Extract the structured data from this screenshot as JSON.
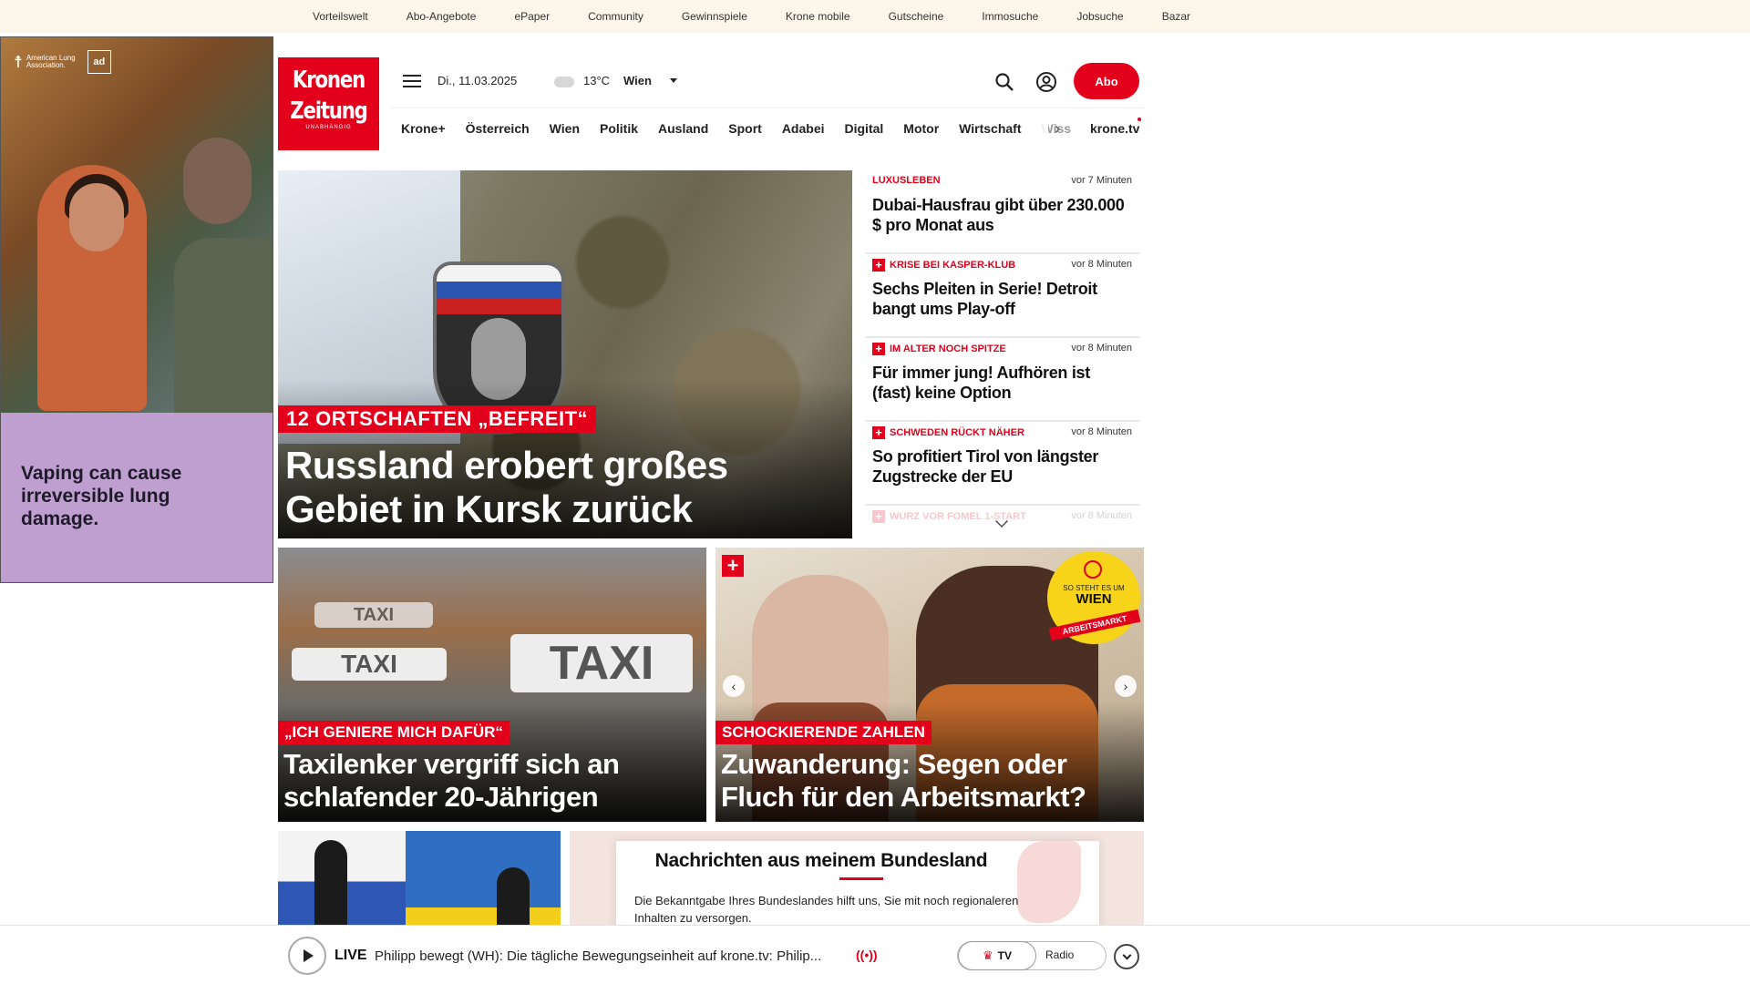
{
  "topbar": {
    "links": [
      "Vorteilswelt",
      "Abo-Angebote",
      "ePaper",
      "Community",
      "Gewinnspiele",
      "Krone mobile",
      "Gutscheine",
      "Immosuche",
      "Jobsuche",
      "Bazar"
    ]
  },
  "ad": {
    "brand": "American Lung Association.",
    "council": "ad",
    "text": "Vaping can cause irreversible lung damage."
  },
  "header": {
    "logo_line1": "Kronen",
    "logo_line2": "Zeitung",
    "logo_sub": "UNABHÄNGIG",
    "date": "Di., 11.03.2025",
    "temperature": "13°C",
    "city": "Wien",
    "abo_label": "Abo",
    "icons": [
      "menu-icon",
      "cloud-icon",
      "search-icon",
      "user-icon"
    ]
  },
  "nav": {
    "items": [
      "Krone+",
      "Österreich",
      "Wien",
      "Politik",
      "Ausland",
      "Sport",
      "Adabei",
      "Digital",
      "Motor",
      "Wirtschaft",
      "Wiss"
    ],
    "tv": "krone.tv"
  },
  "hero": {
    "kicker": "12 ORTSCHAFTEN „BEFREIT“",
    "title": "Russland erobert großes Gebiet in Kursk zurück"
  },
  "ticker": {
    "items": [
      {
        "kicker": "LUXUSLEBEN",
        "plus": false,
        "time": "vor 7 Minuten",
        "title": "Dubai-Hausfrau gibt über 230.000 $ pro Monat aus"
      },
      {
        "kicker": "KRISE BEI KASPER-KLUB",
        "plus": true,
        "time": "vor 8 Minuten",
        "title": "Sechs Pleiten in Serie! Detroit bangt ums Play-off"
      },
      {
        "kicker": "IM ALTER NOCH SPITZE",
        "plus": true,
        "time": "vor 8 Minuten",
        "title": "Für immer jung! Aufhören ist (fast) keine Option"
      },
      {
        "kicker": "SCHWEDEN RÜCKT NÄHER",
        "plus": true,
        "time": "vor 8 Minuten",
        "title": "So profitiert Tirol von längster Zugstrecke der EU"
      },
      {
        "kicker": "WURZ VOR FOMEL 1-START",
        "plus": true,
        "time": "vor 8 Minuten",
        "title": ""
      }
    ]
  },
  "cards": [
    {
      "kicker": "„ICH GENIERE MICH DAFÜR“",
      "title": "Taxilenker vergriff sich an schlafender 20-Jährigen",
      "sign": "TAXI"
    },
    {
      "kicker": "SCHOCKIERENDE ZAHLEN",
      "title": "Zuwanderung: Segen oder Fluch für den Arbeitsmarkt?",
      "badge_small": "SO STEHT ES UM",
      "badge_big": "WIEN",
      "badge_band": "ARBEITSMARKT"
    }
  ],
  "bundesland": {
    "title": "Nachrichten aus meinem Bundesland",
    "text": "Die Bekanntgabe Ihres Bundeslandes hilft uns, Sie mit noch regionaleren Inhalten zu versorgen."
  },
  "player": {
    "live": "LIVE",
    "title": "Philipp bewegt (WH): Die tägliche Bewegungseinheit auf krone.tv: Philip...",
    "wave": "((•))",
    "tv": "TV",
    "radio": "Radio"
  },
  "colors": {
    "accent": "#e2001a",
    "topbar_bg": "#fbf6e9",
    "ad_bg": "#be9fcf"
  }
}
